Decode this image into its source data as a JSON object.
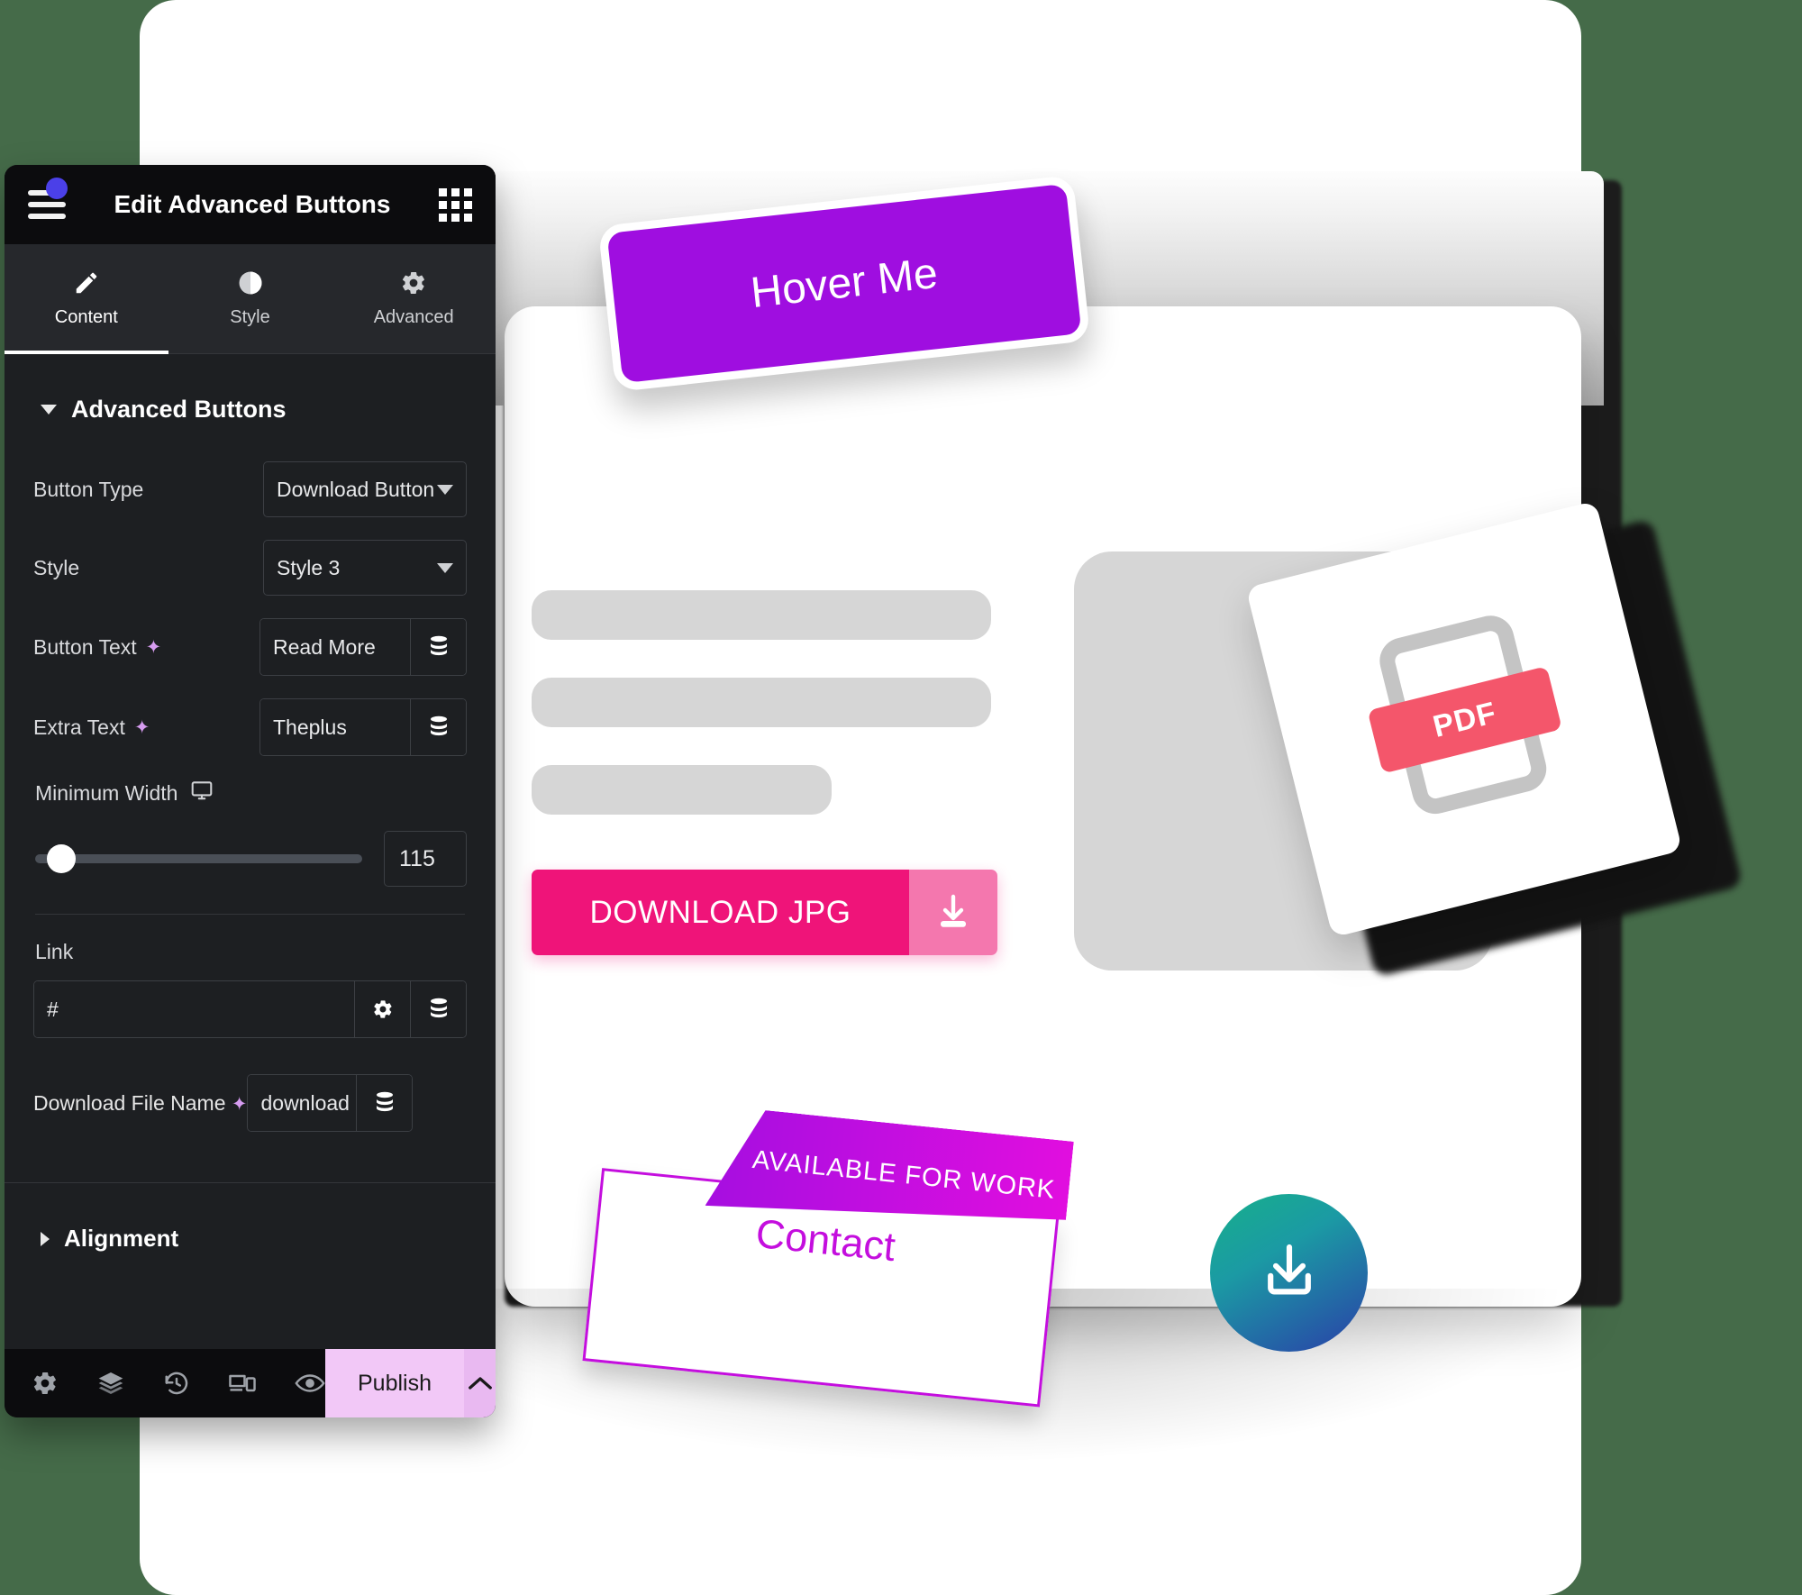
{
  "panel": {
    "header": {
      "title": "Edit Advanced Buttons",
      "menu_icon": "hamburger-menu-icon",
      "grid_icon": "apps-grid-icon",
      "notification_dot": "notification-dot"
    },
    "tabs": [
      {
        "label": "Content",
        "icon": "pencil-icon",
        "active": true
      },
      {
        "label": "Style",
        "icon": "contrast-icon",
        "active": false
      },
      {
        "label": "Advanced",
        "icon": "gear-icon",
        "active": false
      }
    ],
    "section": {
      "title": "Advanced Buttons",
      "expanded": true
    },
    "fields": {
      "button_type": {
        "label": "Button Type",
        "value": "Download Button"
      },
      "style": {
        "label": "Style",
        "value": "Style 3"
      },
      "button_text": {
        "label": "Button Text",
        "value": "Read More",
        "ai_icon": "ai-sparkle-icon",
        "dynamic_icon": "database-icon"
      },
      "extra_text": {
        "label": "Extra Text",
        "value": "Theplus",
        "ai_icon": "ai-sparkle-icon",
        "dynamic_icon": "database-icon"
      },
      "minimum_width": {
        "label": "Minimum Width",
        "value": "115",
        "device_icon": "desktop-monitor-icon",
        "slider_percent": 8
      },
      "link": {
        "label": "Link",
        "value": "#",
        "settings_icon": "gear-icon",
        "dynamic_icon": "database-icon"
      },
      "download_file_name": {
        "label": "Download File Name",
        "value": "download",
        "ai_icon": "ai-sparkle-icon",
        "dynamic_icon": "database-icon"
      }
    },
    "alignment_section": {
      "title": "Alignment",
      "expanded": false
    },
    "footer": {
      "icons": [
        {
          "name": "gear-icon"
        },
        {
          "name": "layers-icon"
        },
        {
          "name": "history-revision-icon"
        },
        {
          "name": "responsive-devices-icon"
        },
        {
          "name": "preview-eye-icon"
        }
      ],
      "publish_label": "Publish",
      "publish_caret_icon": "chevron-up-icon"
    }
  },
  "canvas": {
    "hover_button": {
      "label": "Hover Me",
      "color": "#9f0ee0"
    },
    "download_jpg_button": {
      "label": "DOWNLOAD JPG",
      "color": "#ef1479",
      "icon": "download-tray-icon"
    },
    "contact_card": {
      "ribbon_label": "AVAILABLE FOR WORK",
      "label": "Contact",
      "color": "#c40ede"
    },
    "pdf_card": {
      "badge_label": "PDF",
      "badge_color": "#f4566b",
      "icon": "document-icon"
    },
    "circle_download_button": {
      "icon": "download-tray-icon",
      "gradient_from": "#17b08a",
      "gradient_to": "#2a3fa8"
    }
  },
  "theme": {
    "background": "#456b49",
    "panel_bg": "#1d1f22",
    "accent_purple": "#9f0ee0",
    "accent_pink": "#ef1479",
    "publish_bg": "#f2c8f7"
  }
}
